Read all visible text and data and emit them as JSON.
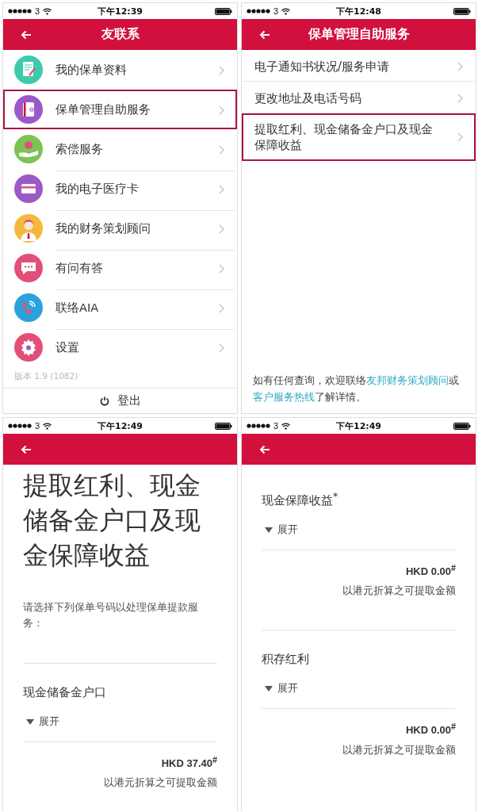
{
  "screens": [
    {
      "kind": "menu",
      "status": {
        "carrier": "3",
        "time": "下午12:39"
      },
      "title": "友联系",
      "items": [
        {
          "label": "我的保单资料",
          "color": "#3ccbab",
          "highlighted": false
        },
        {
          "label": "保单管理自助服务",
          "color": "#9b59c8",
          "highlighted": true
        },
        {
          "label": "索偿服务",
          "color": "#7cc254",
          "highlighted": false
        },
        {
          "label": "我的电子医疗卡",
          "color": "#9b59c8",
          "highlighted": false
        },
        {
          "label": "我的财务策划顾问",
          "color": "#f5b83d",
          "highlighted": false
        },
        {
          "label": "有问有答",
          "color": "#e2507a",
          "highlighted": false
        },
        {
          "label": "联络AIA",
          "color": "#2aa3dc",
          "highlighted": false
        },
        {
          "label": "设置",
          "color": "#e2507a",
          "highlighted": false
        }
      ],
      "version": "版本 1.9 (1082)",
      "logout": "登出"
    },
    {
      "kind": "submenu",
      "status": {
        "carrier": "3",
        "time": "下午12:48"
      },
      "title": "保单管理自助服务",
      "items": [
        {
          "label": "电子通知书状况/服务申请",
          "highlighted": false
        },
        {
          "label": "更改地址及电话号码",
          "highlighted": false
        },
        {
          "label": "提取红利、现金储备金户口及现金保障收益",
          "highlighted": true
        }
      ],
      "footer": [
        {
          "text": "如有任何查询，欢迎联络",
          "link": false
        },
        {
          "text": "友邦财务策划顾问",
          "link": true
        },
        {
          "text": "或",
          "link": false
        },
        {
          "text": "客户服务热线",
          "link": true
        },
        {
          "text": "了解详情。",
          "link": false
        }
      ]
    },
    {
      "kind": "detail",
      "status": {
        "carrier": "3",
        "time": "下午12:49"
      },
      "heading": "提取红利、现金储备金户口及现金保障收益",
      "intro": "请选择下列保单号码以处理保单提款服务：",
      "sections": [
        {
          "title": "现金储备金户口",
          "toggle": "展开",
          "amount": "HKD 37.40$^{#}$",
          "note": "以港元折算之可提取金额"
        }
      ]
    },
    {
      "kind": "detail",
      "status": {
        "carrier": "3",
        "time": "下午12:49"
      },
      "sections": [
        {
          "title": "现金保障收益$^{*}$",
          "toggle": "展开",
          "amount": "HKD 0.00$^{#}$",
          "note": "以港元折算之可提取金额"
        },
        {
          "title": "积存红利",
          "toggle": "展开",
          "amount": "HKD 0.00$^{#}$",
          "note": "以港元折算之可提取金额"
        }
      ]
    }
  ]
}
